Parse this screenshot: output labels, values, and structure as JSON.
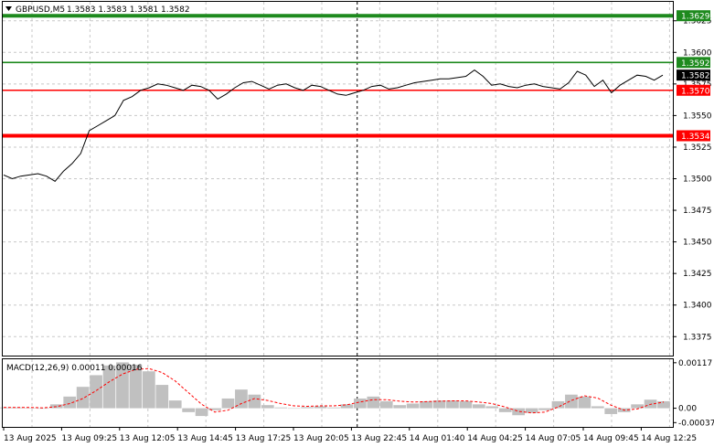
{
  "header": {
    "symbol_label": "GBPUSD,M5",
    "ohlc_text": "1.3583 1.3583 1.3581 1.3582"
  },
  "colors": {
    "price_line": "#000000",
    "resistance": "#1e8a1e",
    "support": "#ff0000",
    "current_price_bg": "#000000",
    "macd_hist": "#c0c0c0",
    "macd_signal": "#ff0000",
    "grid": "#c8c8c8",
    "session_separator": "#000000"
  },
  "chart_data": {
    "type": "line",
    "title": "GBPUSD,M5",
    "ylim": [
      1.336,
      1.364
    ],
    "y_ticks": [
      1.3625,
      1.36,
      1.3575,
      1.355,
      1.3525,
      1.35,
      1.3475,
      1.345,
      1.3425,
      1.34,
      1.3375
    ],
    "x_ticks": [
      "13 Aug 2025",
      "13 Aug 09:25",
      "13 Aug 12:05",
      "13 Aug 14:45",
      "13 Aug 17:25",
      "13 Aug 20:05",
      "13 Aug 22:45",
      "14 Aug 01:40",
      "14 Aug 04:25",
      "14 Aug 07:05",
      "14 Aug 09:45",
      "14 Aug 12:25"
    ],
    "grid": true,
    "session_separator_index": 6.1,
    "series": [
      {
        "values": [
          1.3503,
          1.35,
          1.3502,
          1.3503,
          1.3504,
          1.3502,
          1.3498,
          1.3506,
          1.3512,
          1.352,
          1.3538,
          1.3542,
          1.3546,
          1.355,
          1.3562,
          1.3565,
          1.357,
          1.3572,
          1.3575,
          1.3574,
          1.3572,
          1.357,
          1.3574,
          1.3573,
          1.357,
          1.3563,
          1.3567,
          1.3572,
          1.3576,
          1.3577,
          1.3574,
          1.3571,
          1.3574,
          1.3575,
          1.3572,
          1.357,
          1.3574,
          1.3573,
          1.357,
          1.3567,
          1.3566,
          1.3568,
          1.357,
          1.3573,
          1.3574,
          1.3571,
          1.3572,
          1.3574,
          1.3576,
          1.3577,
          1.3578,
          1.3579,
          1.3579,
          1.358,
          1.3581,
          1.3586,
          1.3581,
          1.3574,
          1.3575,
          1.3573,
          1.3572,
          1.3574,
          1.3575,
          1.3573,
          1.3572,
          1.3571,
          1.3576,
          1.3585,
          1.3582,
          1.3573,
          1.3578,
          1.3568,
          1.3574,
          1.3578,
          1.3582,
          1.3581,
          1.3578,
          1.3582
        ]
      }
    ],
    "levels": [
      {
        "value": 1.3629,
        "label": "1.3629",
        "kind": "resistance",
        "thick": true
      },
      {
        "value": 1.3592,
        "label": "1.3592",
        "kind": "resistance",
        "thick": false
      },
      {
        "value": 1.357,
        "label": "1.3570",
        "kind": "support",
        "thick": false
      },
      {
        "value": 1.3534,
        "label": "1.3534",
        "kind": "support",
        "thick": true
      }
    ],
    "current_price": {
      "value": 1.3582,
      "label": "1.3582"
    },
    "macd": {
      "label": "MACD(12,26,9) 0.00011 0.00016",
      "ylim": [
        -0.00048,
        0.00126
      ],
      "y_ticks": [
        {
          "value": 0.00117,
          "label": "0.00117"
        },
        {
          "value": 0.0,
          "label": "0.00"
        },
        {
          "value": -0.00037,
          "label": "-0.00037"
        }
      ],
      "histogram": [
        2e-05,
        2e-05,
        1e-05,
        0.0,
        0.0001,
        0.0003,
        0.00055,
        0.00085,
        0.0011,
        0.00118,
        0.00112,
        0.00095,
        0.0006,
        0.0002,
        -0.0001,
        -0.0002,
        -5e-05,
        0.00025,
        0.00048,
        0.00035,
        8e-05,
        2e-05,
        0.0,
        3e-05,
        5e-05,
        2e-05,
        0.0001,
        0.00025,
        0.0003,
        0.00018,
        8e-05,
        0.00012,
        0.00018,
        0.0002,
        0.0002,
        0.00018,
        0.0001,
        5e-05,
        -0.0001,
        -0.00018,
        -0.00012,
        -5e-05,
        0.00018,
        0.00035,
        0.0003,
        5e-05,
        -0.00015,
        -0.0001,
        0.0001,
        0.00022,
        0.00018
      ],
      "signal": [
        2e-05,
        2e-05,
        2e-05,
        1e-05,
        4e-05,
        0.00012,
        0.00025,
        0.00045,
        0.00068,
        0.00088,
        0.001,
        0.00102,
        0.00092,
        0.0007,
        0.0004,
        0.0001,
        -0.0001,
        -5e-05,
        0.00012,
        0.00025,
        0.0002,
        0.00012,
        6e-05,
        5e-05,
        6e-05,
        6e-05,
        9e-05,
        0.00016,
        0.00022,
        0.00022,
        0.00018,
        0.00016,
        0.00017,
        0.00018,
        0.00019,
        0.00019,
        0.00016,
        0.00012,
        3e-05,
        -8e-05,
        -0.00012,
        -0.0001,
        3e-05,
        0.0002,
        0.00032,
        0.00026,
        8e-05,
        -5e-05,
        -2e-05,
        0.0001,
        0.00016
      ]
    }
  }
}
